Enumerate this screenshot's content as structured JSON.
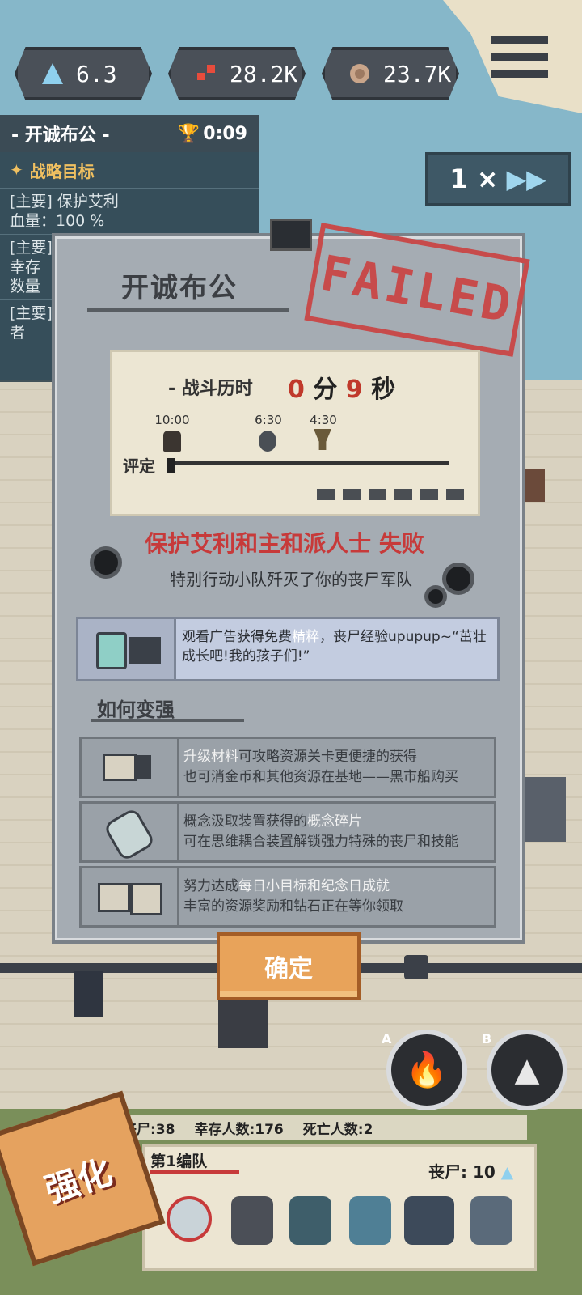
{
  "top_bar": {
    "resources": [
      {
        "icon": "crystal-icon",
        "value": "6.3"
      },
      {
        "icon": "blood-icon",
        "value": "28.2K"
      },
      {
        "icon": "brain-icon",
        "value": "23.7K"
      }
    ]
  },
  "mission": {
    "title": "- 开诚布公 -",
    "timer": "0:09",
    "section": "战略目标",
    "objectives": [
      {
        "label": "[主要] 保护艾利",
        "detail": "血量：100 %"
      },
      {
        "label": "[主要]",
        "detail": "幸存"
      },
      {
        "label": "",
        "detail": "数量"
      },
      {
        "label": "[主要]",
        "detail": "者"
      }
    ]
  },
  "speed": {
    "label": "1 ×"
  },
  "dialog": {
    "title": "开诚布公",
    "stamp": "FAILED",
    "battle_time_label": "- 战斗历时",
    "minutes": "0",
    "minutes_unit": "分",
    "seconds": "9",
    "seconds_unit": "秒",
    "marks": [
      "10:00",
      "6:30",
      "4:30"
    ],
    "rating_label": "评定",
    "fail_title": "保护艾利和主和派人士 失败",
    "fail_desc": "特别行动小队歼灭了你的丧尸军队",
    "ad_text_a": "观看广告获得免费",
    "ad_text_hl": "精粹",
    "ad_text_b": "，丧尸经验upupup~“茁壮成长吧!我的孩子们!”",
    "howto_title": "如何变强",
    "tips": [
      {
        "hl": "升级材料",
        "a": "可攻略资源关卡更便捷的获得",
        "b": "也可消金币和其他资源在基地——黑市船购买"
      },
      {
        "pre": "概念汲取装置获得的",
        "hl": "概念碎片",
        "b": "可在思维耦合装置解锁强力特殊的丧尸和技能"
      },
      {
        "pre": "努力达成",
        "hl": "每日小目标和纪念日成就",
        "b": "丰富的资源奖励和钻石正在等你领取"
      }
    ],
    "confirm": "确定"
  },
  "hud": {
    "zombies": "丧尸:38",
    "survivors": "幸存人数:176",
    "deaths": "死亡人数:2",
    "squad_name": "第1编队",
    "squad_zombies": "丧尸: 10",
    "upgrade": "强化",
    "skill_a_key": "A",
    "skill_b_key": "B"
  },
  "colors": {
    "fail_red": "#c73a3a",
    "confirm_orange": "#e8a35a",
    "panel_gray": "#a5acb3"
  }
}
